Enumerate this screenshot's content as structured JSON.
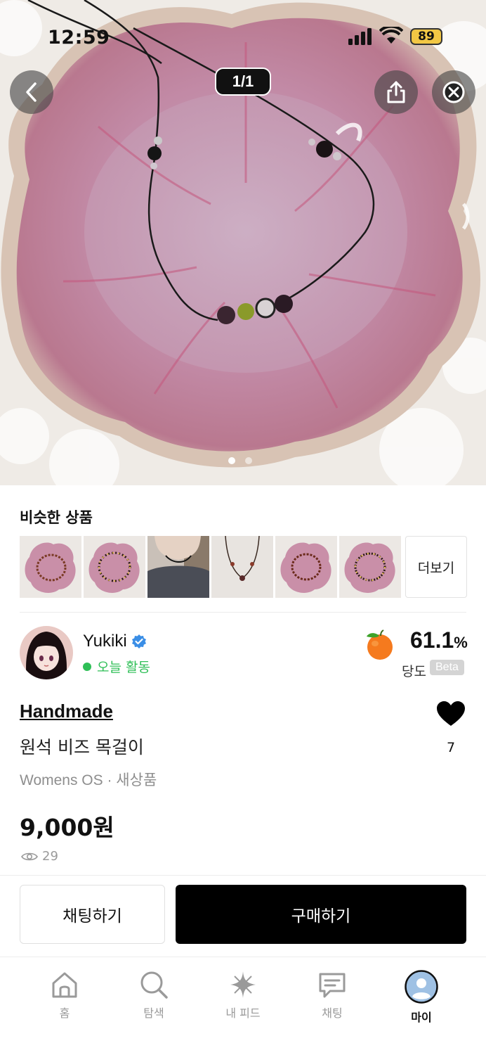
{
  "status_bar": {
    "time": "12:59",
    "battery": "89"
  },
  "gallery": {
    "counter": "1/1",
    "dots": 2,
    "active_dot": 0
  },
  "similar": {
    "title": "비슷한 상품",
    "more_label": "더보기"
  },
  "seller": {
    "name": "Yukiki",
    "activity": "오늘 활동",
    "sweetness_value": "61.1",
    "sweetness_unit": "%",
    "sweetness_label": "당도",
    "beta_label": "Beta"
  },
  "product": {
    "brand": "Handmade",
    "name": "원석 비즈 목걸이",
    "meta": "Womens OS · 새상품",
    "price": "9,000원",
    "views": "29",
    "likes": "7"
  },
  "actions": {
    "chat_label": "채팅하기",
    "buy_label": "구매하기"
  },
  "tabbar": {
    "items": [
      {
        "label": "홈",
        "icon": "home-icon"
      },
      {
        "label": "탐색",
        "icon": "search-icon"
      },
      {
        "label": "내 피드",
        "icon": "sparkle-icon"
      },
      {
        "label": "채팅",
        "icon": "chat-icon"
      },
      {
        "label": "마이",
        "icon": "profile-icon"
      }
    ],
    "active_index": 4
  },
  "colors": {
    "accent_green": "#2fbf57",
    "buy_button": "#000000",
    "verified_blue": "#3a8ee6"
  }
}
